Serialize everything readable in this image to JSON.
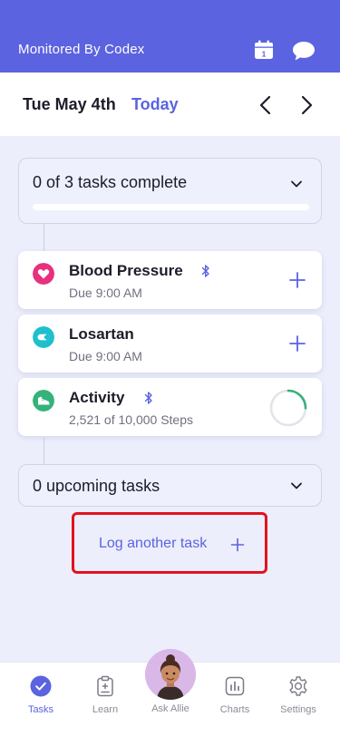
{
  "header": {
    "title": "Monitored By Codex",
    "calendar_day": "1",
    "icons": [
      "calendar-icon",
      "chat-bubble-icon"
    ],
    "background": "#5b63e0"
  },
  "datebar": {
    "date": "Tue May 4th",
    "today": "Today",
    "icons": [
      "chevron-left-icon",
      "chevron-right-icon"
    ]
  },
  "progress": {
    "label": "0 of 3 tasks complete",
    "completed": 0,
    "total": 3,
    "fraction": 0
  },
  "tasks": [
    {
      "title": "Blood Pressure",
      "subtitle": "Due 9:00 AM",
      "icon": "heart-icon",
      "icon_color": "#e8307f",
      "bluetooth": true,
      "action": "plus"
    },
    {
      "title": "Losartan",
      "subtitle": "Due 9:00 AM",
      "icon": "pill-icon",
      "icon_color": "#1fbfcb",
      "bluetooth": false,
      "action": "plus"
    },
    {
      "title": "Activity",
      "subtitle": "2,521 of 10,000 Steps",
      "icon": "shoe-icon",
      "icon_color": "#34b27a",
      "bluetooth": true,
      "action": "progress-ring",
      "progress": 0.2521
    }
  ],
  "upcoming": {
    "label": "0 upcoming tasks"
  },
  "log_task": {
    "label": "Log another task"
  },
  "tabbar": {
    "tabs": [
      {
        "label": "Tasks",
        "icon": "check-circle-icon",
        "active": true
      },
      {
        "label": "Learn",
        "icon": "clipboard-icon",
        "active": false
      },
      {
        "label": "Ask Allie",
        "icon": "avatar-icon",
        "active": false
      },
      {
        "label": "Charts",
        "icon": "bar-chart-icon",
        "active": false
      },
      {
        "label": "Settings",
        "icon": "gear-icon",
        "active": false
      }
    ]
  },
  "colors": {
    "accent": "#5b63e0",
    "highlight_border": "#e3121f",
    "ring_progress": "#34b27a"
  }
}
